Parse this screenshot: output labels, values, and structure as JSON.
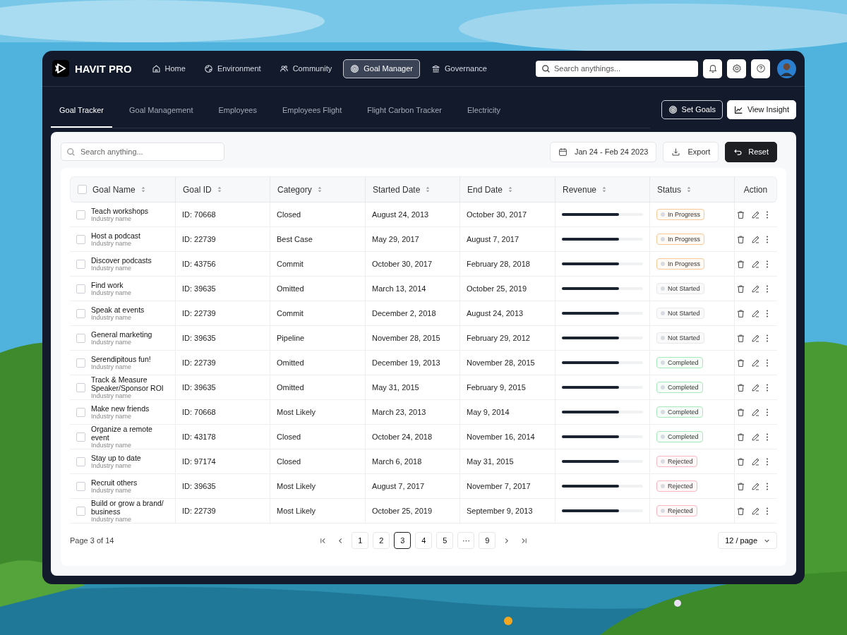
{
  "app": {
    "name": "HAVIT PRO"
  },
  "nav": [
    {
      "label": "Home",
      "selected": false
    },
    {
      "label": "Environment",
      "selected": false
    },
    {
      "label": "Community",
      "selected": false
    },
    {
      "label": "Goal Manager",
      "selected": true
    },
    {
      "label": "Governance",
      "selected": false
    }
  ],
  "top_search": {
    "placeholder": "Search anythings..."
  },
  "tabs": [
    {
      "label": "Goal Tracker",
      "selected": true
    },
    {
      "label": "Goal Management",
      "selected": false
    },
    {
      "label": "Employees",
      "selected": false
    },
    {
      "label": "Employees Flight",
      "selected": false
    },
    {
      "label": "Flight Carbon Tracker",
      "selected": false
    },
    {
      "label": "Electricity",
      "selected": false
    }
  ],
  "tab_buttons": [
    {
      "label": "Set Goals",
      "kind": "outline"
    },
    {
      "label": "View Insight",
      "kind": "solid"
    }
  ],
  "table_search": {
    "placeholder": "Search anything..."
  },
  "date_range": "Jan 24 - Feb 24 2023",
  "export_button": "Export",
  "reset_button": "Reset",
  "table": {
    "select_all": {
      "checked": false
    },
    "columns": [
      {
        "label": "Goal Name",
        "sortable": true
      },
      {
        "label": "Goal ID",
        "sortable": true
      },
      {
        "label": "Category",
        "sortable": true
      },
      {
        "label": "Started Date",
        "sortable": true
      },
      {
        "label": "End Date",
        "sortable": true
      },
      {
        "label": "Revenue",
        "sortable": true
      },
      {
        "label": "Status",
        "sortable": true
      },
      {
        "label": "Action",
        "sortable": false
      }
    ],
    "rows": [
      {
        "checked": false,
        "name": "Teach workshops",
        "sub": "Industry name",
        "id": "ID: 70668",
        "category": "Closed",
        "start": "August 24, 2013",
        "end": "October 30, 2017",
        "level": 0.7,
        "status": {
          "label": "In Progress",
          "kind": "in_progress"
        }
      },
      {
        "checked": false,
        "name": "Host a podcast",
        "sub": "Industry name",
        "id": "ID: 22739",
        "category": "Best Case",
        "start": "May 29, 2017",
        "end": "August 7, 2017",
        "level": 0.7,
        "status": {
          "label": "In Progress",
          "kind": "in_progress"
        }
      },
      {
        "checked": false,
        "name": "Discover podcasts",
        "sub": "Industry name",
        "id": "ID: 43756",
        "category": "Commit",
        "start": "October 30, 2017",
        "end": "February 28, 2018",
        "level": 0.7,
        "status": {
          "label": "In Progress",
          "kind": "in_progress"
        }
      },
      {
        "checked": false,
        "name": "Find work",
        "sub": "Industry name",
        "id": "ID: 39635",
        "category": "Omitted",
        "start": "March 13, 2014",
        "end": "October 25, 2019",
        "level": 0.7,
        "status": {
          "label": "Not Started",
          "kind": "not_started"
        }
      },
      {
        "checked": false,
        "name": "Speak at events",
        "sub": "Industry name",
        "id": "ID: 22739",
        "category": "Commit",
        "start": "December 2, 2018",
        "end": "August 24, 2013",
        "level": 0.7,
        "status": {
          "label": "Not Started",
          "kind": "not_started"
        }
      },
      {
        "checked": false,
        "name": "General marketing",
        "sub": "Industry name",
        "id": "ID: 39635",
        "category": "Pipeline",
        "start": "November 28, 2015",
        "end": "February 29, 2012",
        "level": 0.7,
        "status": {
          "label": "Not Started",
          "kind": "not_started"
        }
      },
      {
        "checked": false,
        "name": "Serendipitous fun!",
        "sub": "Industry name",
        "id": "ID: 22739",
        "category": "Omitted",
        "start": "December 19, 2013",
        "end": "November 28, 2015",
        "level": 0.7,
        "status": {
          "label": "Completed",
          "kind": "completed"
        }
      },
      {
        "checked": false,
        "name": "Track & Measure Speaker/Sponsor ROI",
        "sub": "Industry name",
        "id": "ID: 39635",
        "category": "Omitted",
        "start": "May 31, 2015",
        "end": "February 9, 2015",
        "level": 0.7,
        "status": {
          "label": "Completed",
          "kind": "completed"
        }
      },
      {
        "checked": false,
        "name": "Make new friends",
        "sub": "Industry name",
        "id": "ID: 70668",
        "category": "Most Likely",
        "start": "March 23, 2013",
        "end": "May 9, 2014",
        "level": 0.7,
        "status": {
          "label": "Completed",
          "kind": "completed"
        }
      },
      {
        "checked": false,
        "name": "Organize a remote event",
        "sub": "Industry name",
        "id": "ID: 43178",
        "category": "Closed",
        "start": "October 24, 2018",
        "end": "November 16, 2014",
        "level": 0.7,
        "status": {
          "label": "Completed",
          "kind": "completed"
        }
      },
      {
        "checked": false,
        "name": "Stay up to date",
        "sub": "Industry name",
        "id": "ID: 97174",
        "category": "Closed",
        "start": "March 6, 2018",
        "end": "May 31, 2015",
        "level": 0.7,
        "status": {
          "label": "Rejected",
          "kind": "rejected"
        }
      },
      {
        "checked": false,
        "name": "Recruit others",
        "sub": "Industry name",
        "id": "ID: 39635",
        "category": "Most Likely",
        "start": "August 7, 2017",
        "end": "November 7, 2017",
        "level": 0.7,
        "status": {
          "label": "Rejected",
          "kind": "rejected"
        }
      },
      {
        "checked": false,
        "name": "Build or grow a brand/ business",
        "sub": "Industry name",
        "id": "ID: 22739",
        "category": "Most Likely",
        "start": "October 25, 2019",
        "end": "September 9, 2013",
        "level": 0.7,
        "status": {
          "label": "Rejected",
          "kind": "rejected"
        }
      }
    ]
  },
  "pagination": {
    "summary": "Page 3 of 14",
    "pages": [
      {
        "label": "1",
        "selected": false
      },
      {
        "label": "2",
        "selected": false
      },
      {
        "label": "3",
        "selected": true
      },
      {
        "label": "4",
        "selected": false
      },
      {
        "label": "5",
        "selected": false
      },
      {
        "label": "···",
        "selected": false
      },
      {
        "label": "9",
        "selected": false
      }
    ],
    "page_size": "12 / page"
  }
}
